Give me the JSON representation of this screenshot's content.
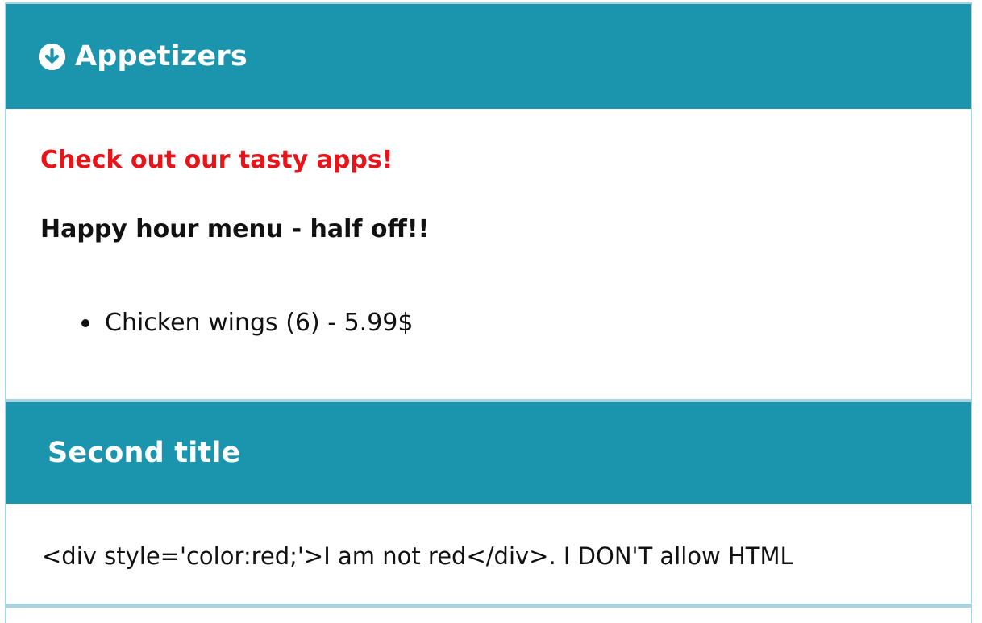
{
  "sections": [
    {
      "title": "Appetizers",
      "icon": "chevron-down-circle-icon",
      "expanded": true,
      "promo": "Check out our tasty apps!",
      "subheading": "Happy hour menu - half off!!",
      "items": [
        "Chicken wings (6) - 5.99$"
      ]
    },
    {
      "title": "Second title",
      "expanded": true,
      "body": "<div style='color:red;'>I am not red</div>. I DON'T allow HTML"
    }
  ],
  "colors": {
    "header_bg": "#1b95ae",
    "border": "#a8d3e0",
    "promo_text": "#e8141a"
  }
}
